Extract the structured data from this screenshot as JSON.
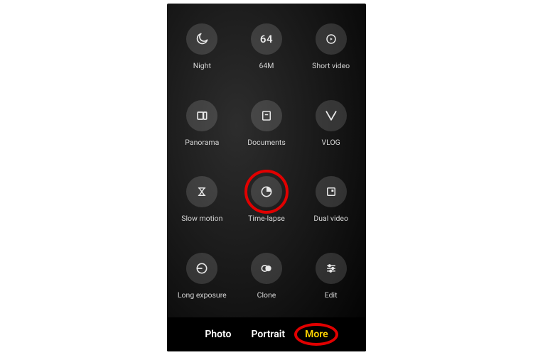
{
  "modes": [
    {
      "id": "night",
      "label": "Night",
      "icon": "moon"
    },
    {
      "id": "64m",
      "label": "64M",
      "icon": "num",
      "num": "64"
    },
    {
      "id": "short-video",
      "label": "Short video",
      "icon": "play-circle"
    },
    {
      "id": "panorama",
      "label": "Panorama",
      "icon": "pano"
    },
    {
      "id": "documents",
      "label": "Documents",
      "icon": "doc"
    },
    {
      "id": "vlog",
      "label": "VLOG",
      "icon": "vlog"
    },
    {
      "id": "slow-motion",
      "label": "Slow motion",
      "icon": "hourglass"
    },
    {
      "id": "time-lapse",
      "label": "Time-lapse",
      "icon": "timelapse",
      "highlight": true
    },
    {
      "id": "dual-video",
      "label": "Dual video",
      "icon": "dual"
    },
    {
      "id": "long-exposure",
      "label": "Long exposure",
      "icon": "long-exposure"
    },
    {
      "id": "clone",
      "label": "Clone",
      "icon": "clone"
    },
    {
      "id": "edit",
      "label": "Edit",
      "icon": "sliders"
    }
  ],
  "tabs": {
    "photo": "Photo",
    "portrait": "Portrait",
    "more": "More"
  },
  "active_tab": "more"
}
